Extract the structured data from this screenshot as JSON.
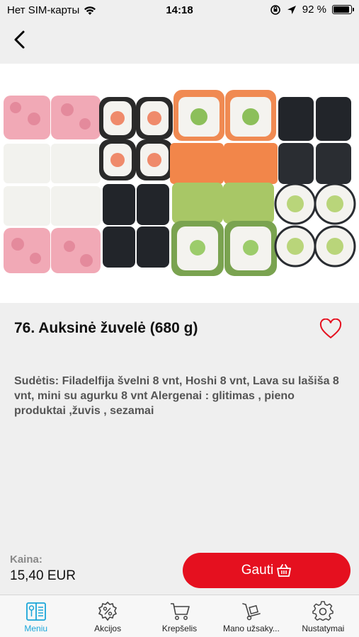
{
  "status": {
    "carrier": "Нет SIM-карты",
    "time": "14:18",
    "battery": "92 %",
    "battery_level": 0.92
  },
  "product": {
    "title": "76. Auksinė žuvelė (680 g)",
    "description": "Sudėtis: Filadelfija švelni 8 vnt, Hoshi 8 vnt, Lava su lašiša 8 vnt, mini su agurku 8 vnt Alergenai : glitimas , pieno produktai ,žuvis , sezamai",
    "price_label": "Kaina:",
    "price": "15,40 EUR",
    "buy_label": "Gauti"
  },
  "tabs": [
    {
      "label": "Meniu",
      "icon": "menu-book-icon",
      "active": true
    },
    {
      "label": "Akcijos",
      "icon": "discount-badge-icon",
      "active": false
    },
    {
      "label": "Krepšelis",
      "icon": "cart-icon",
      "active": false
    },
    {
      "label": "Mano užsaky...",
      "icon": "hand-truck-icon",
      "active": false
    },
    {
      "label": "Nustatymai",
      "icon": "gear-icon",
      "active": false
    }
  ],
  "colors": {
    "accent": "#e5101f",
    "tab_active": "#1aa6d9",
    "background": "#efefef"
  }
}
